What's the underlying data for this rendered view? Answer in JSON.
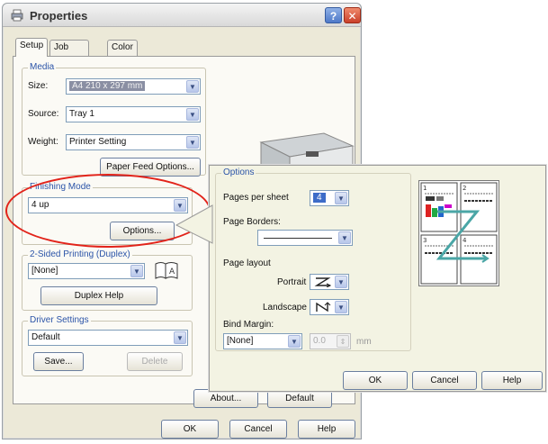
{
  "window": {
    "title": "Properties",
    "help_label": "?",
    "close_label": "✕"
  },
  "tabs": [
    {
      "label": "Setup",
      "active": true
    },
    {
      "label": "Job Options",
      "active": false
    },
    {
      "label": "Color",
      "active": false
    }
  ],
  "media": {
    "legend": "Media",
    "size_label": "Size:",
    "size_value": "A4 210 x 297 mm",
    "source_label": "Source:",
    "source_value": "Tray 1",
    "weight_label": "Weight:",
    "weight_value": "Printer Setting",
    "paper_feed_button": "Paper Feed Options..."
  },
  "finishing": {
    "legend": "Finishing Mode",
    "value": "4 up",
    "options_button": "Options..."
  },
  "duplex": {
    "legend": "2-Sided Printing (Duplex)",
    "value": "[None]",
    "help_button": "Duplex Help"
  },
  "driver": {
    "legend": "Driver Settings",
    "value": "Default",
    "save_button": "Save...",
    "delete_button": "Delete"
  },
  "hidden_buttons": {
    "about": "About...",
    "default": "Default"
  },
  "footer": {
    "ok": "OK",
    "cancel": "Cancel",
    "help": "Help"
  },
  "options_dialog": {
    "legend": "Options",
    "pages_per_sheet_label": "Pages per sheet",
    "pages_per_sheet_value": "4",
    "page_borders_label": "Page Borders:",
    "page_borders_value": "",
    "page_layout_label": "Page layout",
    "portrait_label": "Portrait",
    "landscape_label": "Landscape",
    "bind_margin_label": "Bind Margin:",
    "bind_margin_value": "[None]",
    "margin_amount": "0.0",
    "margin_unit": "mm",
    "ok": "OK",
    "cancel": "Cancel",
    "help": "Help",
    "page_numbers": [
      "1",
      "2",
      "3",
      "4"
    ]
  },
  "colors": {
    "accent": "#2b54a8",
    "highlight": "#e2231a"
  }
}
